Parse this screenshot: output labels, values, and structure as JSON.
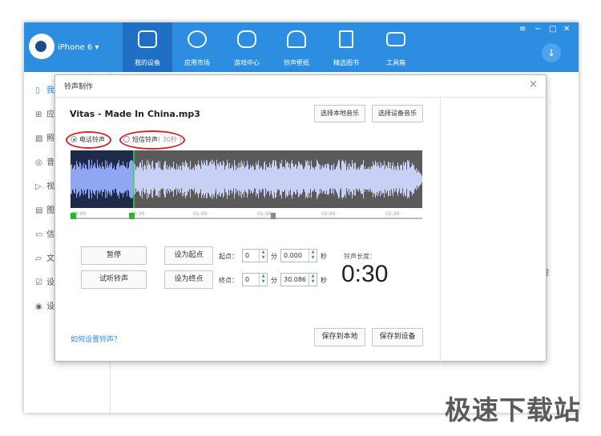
{
  "app": {
    "device_name": "iPhone 6 ▾",
    "nav": [
      {
        "label": "我的设备",
        "icon": "device-icon"
      },
      {
        "label": "应用市场",
        "icon": "apps-icon"
      },
      {
        "label": "游戏中心",
        "icon": "gamepad-icon"
      },
      {
        "label": "铃声壁纸",
        "icon": "bell-icon"
      },
      {
        "label": "精选图书",
        "icon": "book-icon"
      },
      {
        "label": "工具箱",
        "icon": "toolbox-icon"
      }
    ],
    "window_controls": {
      "menu": "≡",
      "minimize": "−",
      "maximize": "□",
      "close": "✕"
    },
    "download": "↓",
    "accent": "#2d8de1"
  },
  "sidebar": {
    "items": [
      {
        "icon": "▯",
        "label": "我"
      },
      {
        "icon": "⊞",
        "label": "应"
      },
      {
        "icon": "▨",
        "label": "照"
      },
      {
        "icon": "◎",
        "label": "音"
      },
      {
        "icon": "▷",
        "label": "视"
      },
      {
        "icon": "▤",
        "label": "图"
      },
      {
        "icon": "▭",
        "label": "信"
      },
      {
        "icon": "▱",
        "label": "文"
      },
      {
        "icon": "☑",
        "label": "设"
      },
      {
        "icon": "◉",
        "label": "设"
      }
    ]
  },
  "background_text": "理",
  "dialog": {
    "title": "铃声制作",
    "close": "×",
    "song": "Vitas - Made In China.mp3",
    "btn_local_music": "选择本地音乐",
    "btn_device_music": "选择设备音乐",
    "radio_phone": "电话铃声",
    "radio_sms": "短信铃声",
    "radio_sms_hint": "( 30秒 )",
    "ticks": [
      "00:00",
      "00:30",
      "01:00",
      "01:30",
      "02:00",
      "02:30"
    ],
    "btn_pause": "暂停",
    "btn_preview": "试听铃声",
    "btn_set_start": "设为起点",
    "btn_set_end": "设为终点",
    "start_label": "起点：",
    "end_label": "终点：",
    "min_unit": "分",
    "sec_unit": "秒",
    "start_min": "0",
    "start_sec": "0.000",
    "end_min": "0",
    "end_sec": "30.086",
    "length_label": "铃声长度：",
    "length_value": "0:30",
    "help_link": "如何设置铃声？",
    "btn_save_local": "保存到本地",
    "btn_save_device": "保存到设备",
    "selection_start_fraction": 0.0,
    "selection_end_fraction": 0.18
  },
  "watermark": "极速下载站"
}
